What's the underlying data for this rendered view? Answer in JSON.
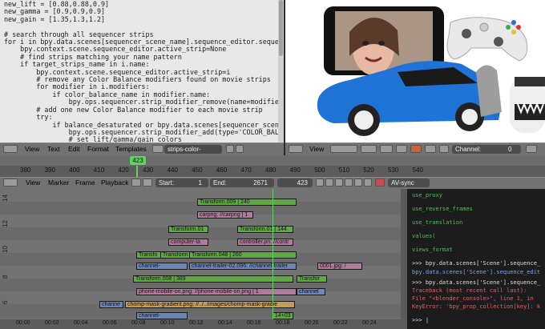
{
  "editor": {
    "lines": [
      "new_lift = [0.88,0.88,0.9]",
      "new_gamma = [0.9,0.9,0.9]",
      "new_gain = [1.35,1.3,1.2]",
      "",
      "# search through all sequencer strips",
      "for i in bpy.data.scenes[sequencer_scene_name].sequence_editor.sequences:",
      "    bpy.context.scene.sequence_editor.active_strip=None",
      "    # find strips matching your name pattern",
      "    if target_strips_name in i.name:",
      "        bpy.context.scene.sequence_editor.active_strip=i",
      "        # remove any Color Balance modifiers found on movie strips",
      "        for modifier in i.modifiers:",
      "            if color_balance_name in modifier.name:",
      "                bpy.ops.sequencer.strip_modifier_remove(name=modifier.name)",
      "        # add one new Color Balance modifier to each movie strip",
      "        try:",
      "            if balance_desaturated or bpy.data.scenes[sequencer_scene_name].s",
      "                bpy.ops.sequencer.strip_modifier_add(type='COLOR_BALANCE')",
      "                # set lift/gamma/gain colors"
    ]
  },
  "editor_header": {
    "view": "View",
    "text": "Text",
    "edit": "Edit",
    "format": "Format",
    "templates": "Templates",
    "file": "strips-color-balance"
  },
  "preview_header": {
    "view": "View",
    "channel": "Channel:",
    "channel_value": "0"
  },
  "timeline": {
    "current_frame": "423",
    "ticks": [
      "380",
      "390",
      "400",
      "410",
      "420",
      "430",
      "440",
      "450",
      "460",
      "470",
      "480",
      "490",
      "500",
      "510",
      "520",
      "530",
      "540"
    ]
  },
  "seq_header": {
    "view": "View",
    "marker": "Marker",
    "frame": "Frame",
    "playback": "Playback",
    "start_label": "Start:",
    "start_value": "1",
    "end_label": "End:",
    "end_value": "2671",
    "frame_value": "423",
    "sync": "AV-sync"
  },
  "sequencer": {
    "channel_numbers": [
      "14",
      "12",
      "10",
      "8",
      "6"
    ],
    "strips": [
      {
        "label": "Transform.009 | 240",
        "color": "green"
      },
      {
        "label": "carpng: //carpng | 1",
        "color": "pink"
      },
      {
        "label": "Transform.01",
        "color": "green"
      },
      {
        "label": "Transform.01 | 144",
        "color": "green"
      },
      {
        "label": "computer-la",
        "color": "pink"
      },
      {
        "label": "controller.pn: //contr",
        "color": "pink"
      },
      {
        "label": "Transfo",
        "color": "green"
      },
      {
        "label": "Transform",
        "color": "green"
      },
      {
        "label": "Transform.048 | 260",
        "color": "green"
      },
      {
        "label": "channel-",
        "color": "blue"
      },
      {
        "label": "channel-trailer-02.096: //channel-trailer",
        "color": "blue"
      },
      {
        "label": "0001.jpg: /",
        "color": "pink"
      },
      {
        "label": "Transform.008 | 389",
        "color": "green"
      },
      {
        "label": "Transfor",
        "color": "green"
      },
      {
        "label": "phone-mobile-on.png: //phone-mobile-on.png | 1",
        "color": "pink"
      },
      {
        "label": "channel",
        "color": "blue"
      },
      {
        "label": "channe",
        "color": "blue"
      },
      {
        "label": "chomp-mask-gradient.png: //../../images/chomp-mask-gradie",
        "color": "orange"
      },
      {
        "label": "channel-",
        "color": "blue"
      },
      {
        "label": "14+03",
        "color": "green"
      }
    ],
    "time_labels": [
      "00:00",
      "00:02",
      "00:04",
      "00:06",
      "00:08",
      "00:10",
      "00:12",
      "00:14",
      "00:16",
      "00:18",
      "00:20",
      "00:22",
      "00:24"
    ]
  },
  "console": {
    "lines": [
      {
        "text": "use_proxy",
        "color": "#4fbf4f"
      },
      {
        "text": "use_reverse_frames",
        "color": "#4fbf4f"
      },
      {
        "text": "use_translation",
        "color": "#4fbf4f"
      },
      {
        "text": "values(",
        "color": "#4fbf4f"
      },
      {
        "text": "views_format",
        "color": "#4fbf4f"
      },
      {
        "text": ">>> bpy.data.scenes['Scene'].sequence_",
        "color": "#dddddd"
      },
      {
        "text": "bpy.data.scenes['Scene'].sequence_edit",
        "color": "#6ea8ff"
      },
      {
        "text": ">>> bpy.data.scenes['Scene'].sequence_",
        "color": "#dddddd"
      },
      {
        "text": "Traceback (most recent call last):",
        "color": "#e06060"
      },
      {
        "text": "  File \"<blender_console>\", line 1, in",
        "color": "#e06060"
      },
      {
        "text": "KeyError: 'bpy_prop_collection[key]: k",
        "color": "#e06060"
      },
      {
        "text": ">>> |",
        "color": "#dddddd"
      }
    ]
  },
  "colors": {
    "strip_green": "#5fa843",
    "strip_blue": "#6d86b8",
    "strip_pink": "#b27a9a",
    "strip_orange": "#c79a5a",
    "playhead": "#5fd35f",
    "car": "#1f73d6"
  }
}
